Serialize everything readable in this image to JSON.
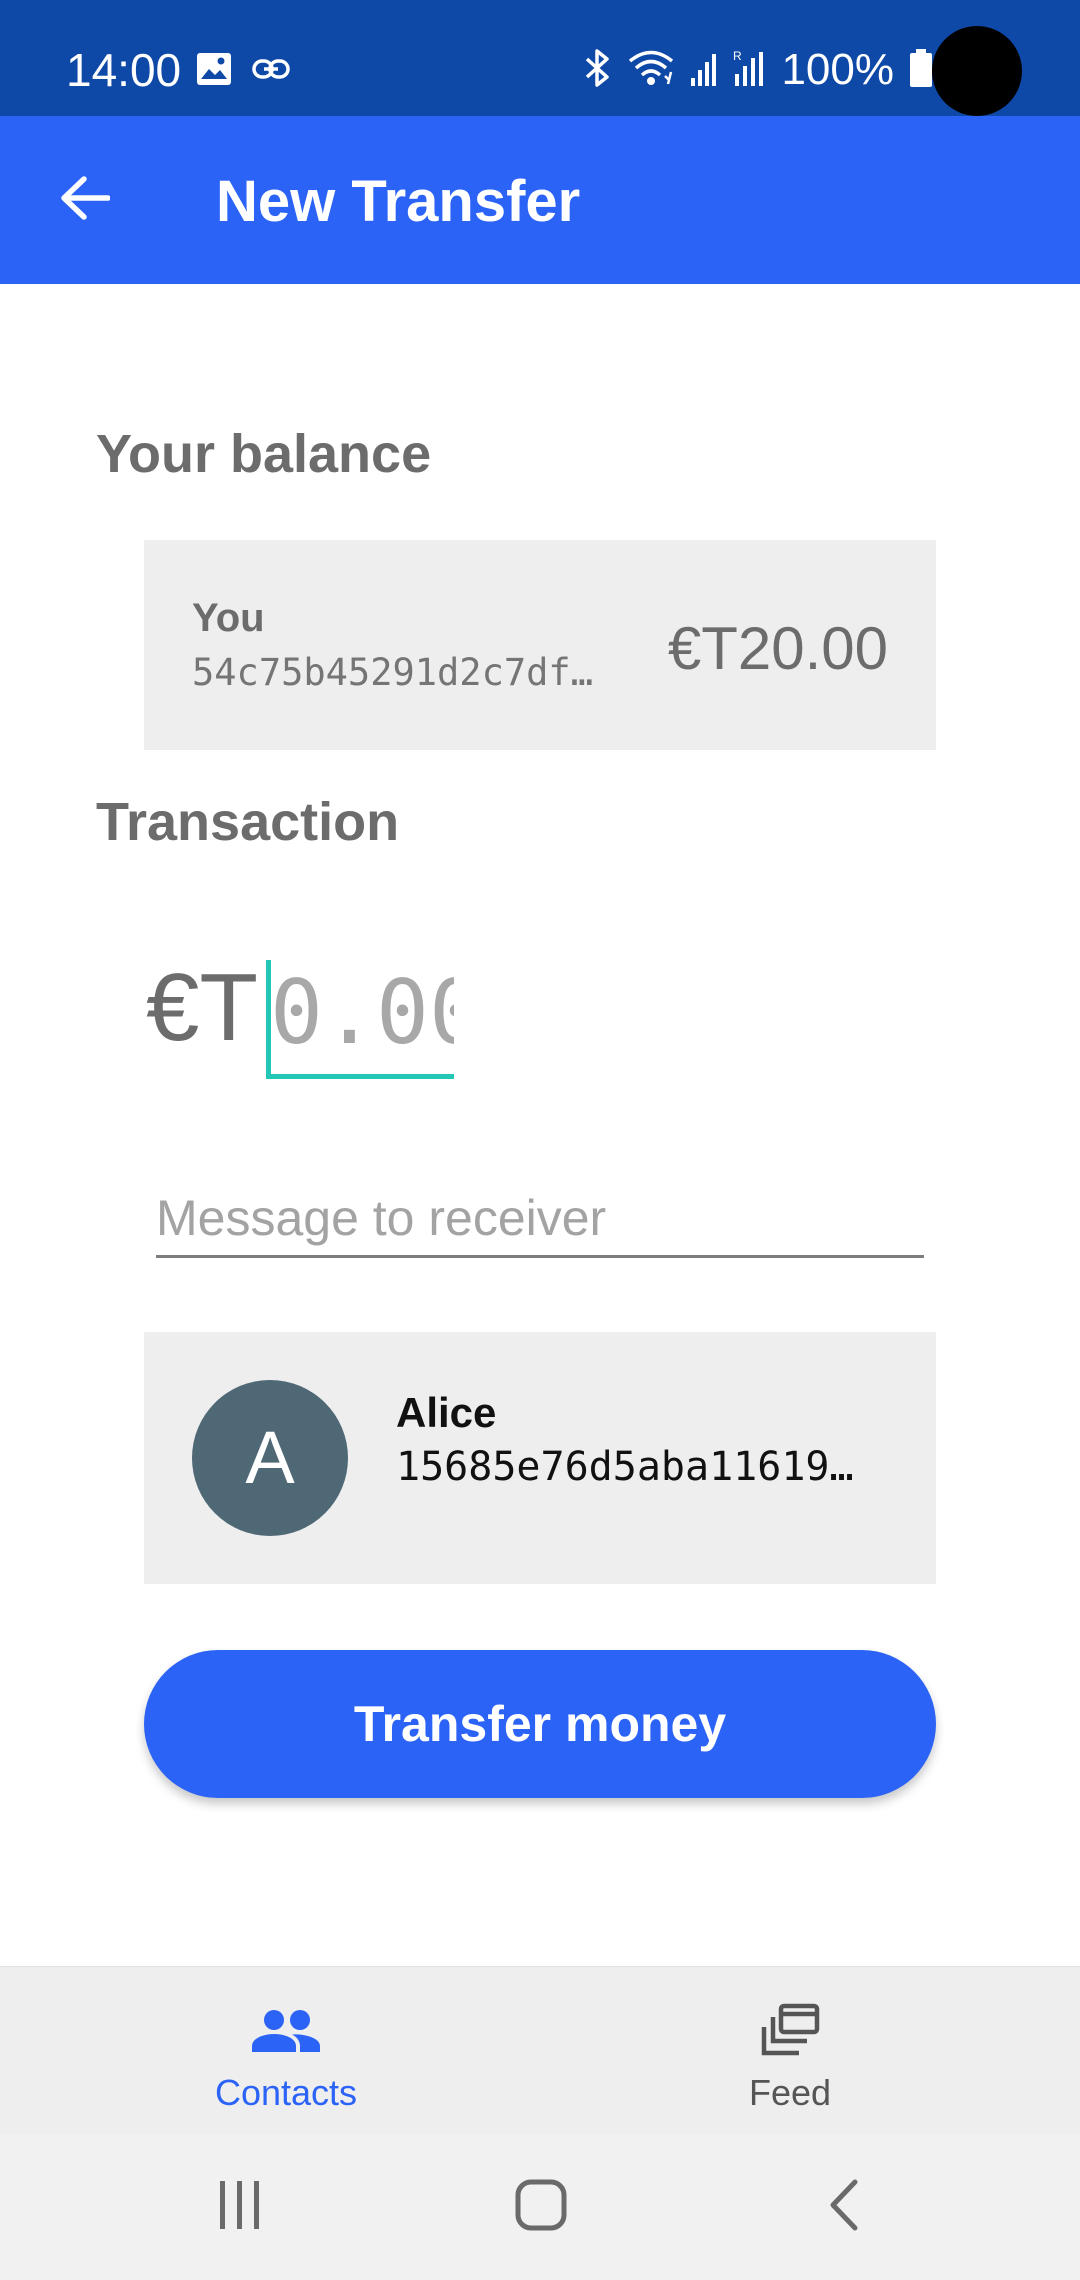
{
  "status_bar": {
    "time": "14:00",
    "left_icons": [
      "image-icon",
      "link-icon"
    ],
    "right_icons": [
      "bluetooth-icon",
      "wifi-icon",
      "signal-icon",
      "signal-roaming-icon",
      "battery-icon"
    ],
    "battery_percent": "100%",
    "background_color": "#0f49a7"
  },
  "app_bar": {
    "title": "New Transfer",
    "back_icon": "arrow-back-icon",
    "background_color": "#2c63f7"
  },
  "balance_section": {
    "title": "Your balance",
    "card": {
      "name": "You",
      "public_key": "54c75b45291d2c7df…",
      "amount": "€T20.00"
    }
  },
  "transaction_section": {
    "title": "Transaction",
    "currency_prefix": "€T",
    "amount": {
      "value": "",
      "placeholder": "0.00"
    },
    "message": {
      "value": "",
      "placeholder": "Message to receiver"
    },
    "recipient": {
      "avatar_initial": "A",
      "name": "Alice",
      "public_key": "15685e76d5aba11619…"
    },
    "submit_label": "Transfer money"
  },
  "bottom_nav": {
    "items": [
      {
        "label": "Contacts",
        "icon": "people-icon",
        "active": true
      },
      {
        "label": "Feed",
        "icon": "feed-icon",
        "active": false
      }
    ],
    "active_color": "#2c63f7"
  },
  "system_nav": {
    "buttons": [
      "recent-apps-icon",
      "home-icon",
      "back-chevron-icon"
    ]
  },
  "colors": {
    "accent": "#2c63f7",
    "input_focus": "#22c7b6",
    "avatar": "#4f6876"
  }
}
